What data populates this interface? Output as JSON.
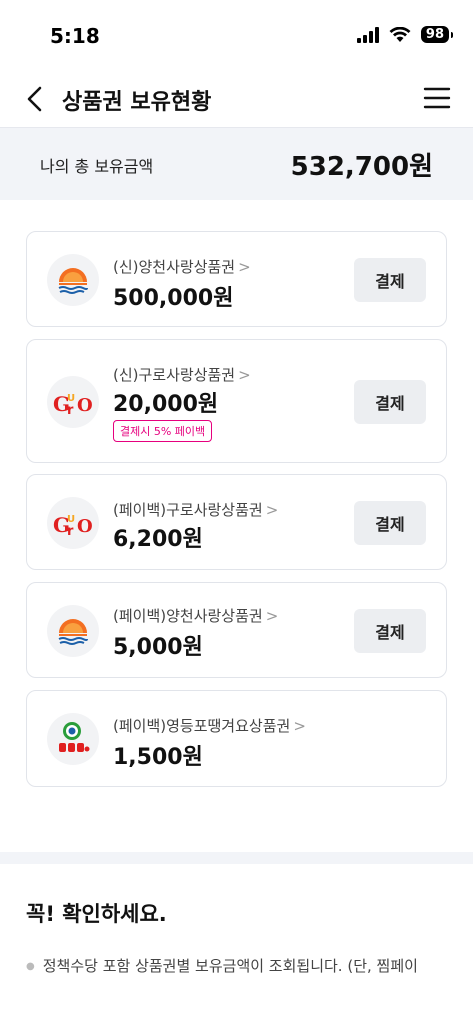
{
  "status": {
    "time": "5:18",
    "battery": "98"
  },
  "header": {
    "title": "상품권 보유현황"
  },
  "total": {
    "label": "나의 총 보유금액",
    "amount": "532,700원"
  },
  "cards": [
    {
      "name": "(신)양천사랑상품권",
      "chevron": ">",
      "amount": "500,000원",
      "pay_label": "결제",
      "logo": "yangcheon-sun-logo"
    },
    {
      "name": "(신)구로사랑상품권",
      "chevron": ">",
      "amount": "20,000원",
      "pay_label": "결제",
      "badge": "결제시 5% 페이백",
      "logo": "guro-logo"
    },
    {
      "name": "(페이백)구로사랑상품권",
      "chevron": ">",
      "amount": "6,200원",
      "pay_label": "결제",
      "logo": "guro-logo"
    },
    {
      "name": "(페이백)양천사랑상품권",
      "chevron": ">",
      "amount": "5,000원",
      "pay_label": "결제",
      "logo": "yangcheon-sun-logo"
    },
    {
      "name": "(페이백)영등포땡겨요상품권",
      "chevron": ">",
      "amount": "1,500원",
      "logo": "yeongdeungpo-logo"
    }
  ],
  "notice": {
    "title": "꼭! 확인하세요.",
    "items": [
      "정책수당 포함 상품권별 보유금액이 조회됩니다. (단, 찜페이"
    ]
  },
  "colors": {
    "accent_pink": "#e6007e",
    "band": "#f2f4f8",
    "pay_button": "#eceef1"
  }
}
